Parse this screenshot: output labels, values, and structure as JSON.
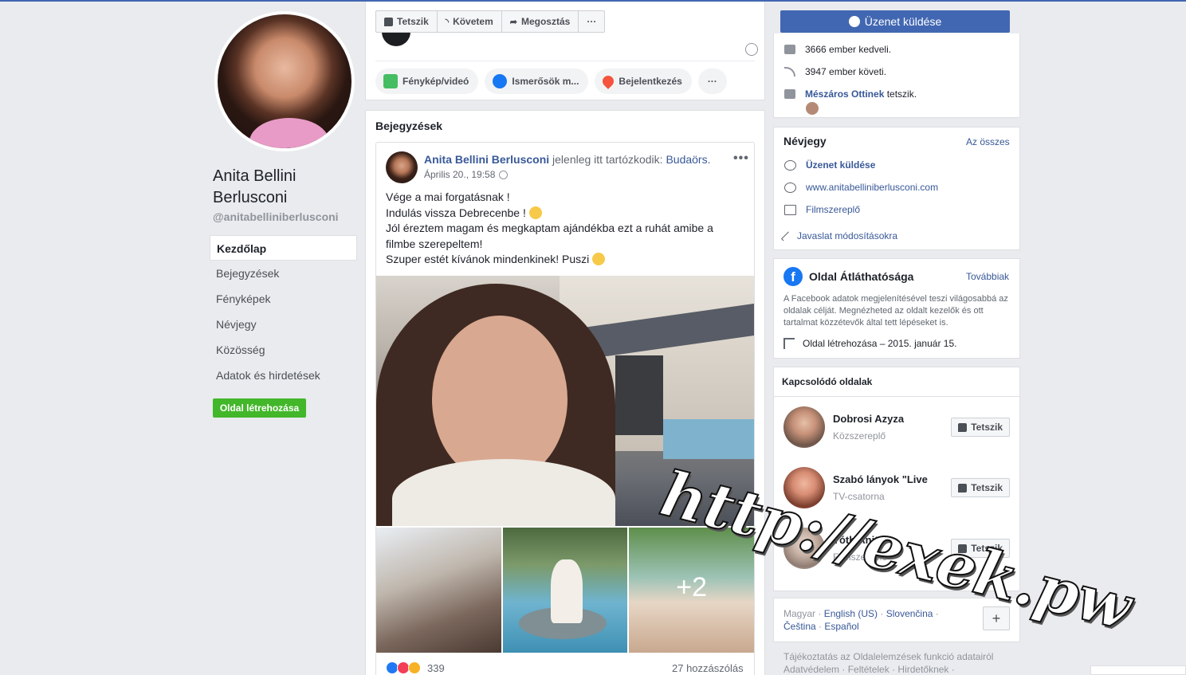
{
  "page": {
    "name": "Anita Bellini Berlusconi",
    "handle": "@anitabelliniberlusconi"
  },
  "left_nav": {
    "items": [
      {
        "label": "Kezdőlap",
        "active": true
      },
      {
        "label": "Bejegyzések"
      },
      {
        "label": "Fényképek"
      },
      {
        "label": "Névjegy"
      },
      {
        "label": "Közösség"
      },
      {
        "label": "Adatok és hirdetések"
      }
    ],
    "create_page": "Oldal létrehozása"
  },
  "action_bar": {
    "like": "Tetszik",
    "follow": "Követem",
    "share": "Megosztás",
    "more": "···"
  },
  "composer": {
    "photo": "Fénykép/videó",
    "friends": "Ismerősök m...",
    "checkin": "Bejelentkezés",
    "more": "···"
  },
  "posts": {
    "title": "Bejegyzések",
    "post": {
      "author": "Anita Bellini Berlusconi",
      "location_prefix": "jelenleg itt tartózkodik:",
      "location": "Budaörs.",
      "date": "Április 20., 19:58",
      "lines": [
        "Vége a mai forgatásnak !",
        "Indulás vissza Debrecenbe !",
        "Jól éreztem magam és megkaptam ajándékba ezt a ruhát amibe a filmbe szerepeltem!",
        "Szuper estét kívánok mindenkinek! Puszi"
      ],
      "extra_photos": "+2",
      "reaction_count": "339",
      "comments": "27 hozzászólás",
      "menu": "•••"
    }
  },
  "right": {
    "send_message": "Üzenet küldése",
    "stats": {
      "likes": "3666 ember kedveli.",
      "follows": "3947 ember követi.",
      "friend_name": "Mészáros Ottinek",
      "friend_suffix": "tetszik."
    },
    "about": {
      "title": "Névjegy",
      "see_all": "Az összes",
      "message": "Üzenet küldése",
      "website": "www.anitabelliniberlusconi.com",
      "category": "Filmszereplő",
      "suggest": "Javaslat módosításokra"
    },
    "transparency": {
      "title": "Oldal Átláthatósága",
      "more": "Továbbiak",
      "text": "A Facebook adatok megjelenítésével teszi világosabbá az oldalak célját. Megnézheted az oldalt kezelők és ott tartalmat közzétevők által tett lépéseket is.",
      "created": "Oldal létrehozása – 2015. január 15."
    },
    "related": {
      "title": "Kapcsolódó oldalak",
      "items": [
        {
          "name": "Dobrosi Azyza",
          "category": "Közszereplő",
          "button": "Tetszik"
        },
        {
          "name": "Szabó lányok \"Live",
          "category": "TV-csatorna",
          "button": "Tetszik"
        },
        {
          "name": "Tóth Anita",
          "category": "Filmszereplő",
          "button": "Tetszik"
        }
      ]
    },
    "languages": {
      "current": "Magyar",
      "list": [
        "English (US)",
        "Slovenčina",
        "Čeština",
        "Español"
      ],
      "plus": "+"
    },
    "footer": {
      "line1": "Tájékoztatás az Oldalelemzések funkció adatairól",
      "line2": "Adatvédelem · Feltételek · Hirdetőknek ·"
    }
  },
  "watermark": "http://exek.pw"
}
